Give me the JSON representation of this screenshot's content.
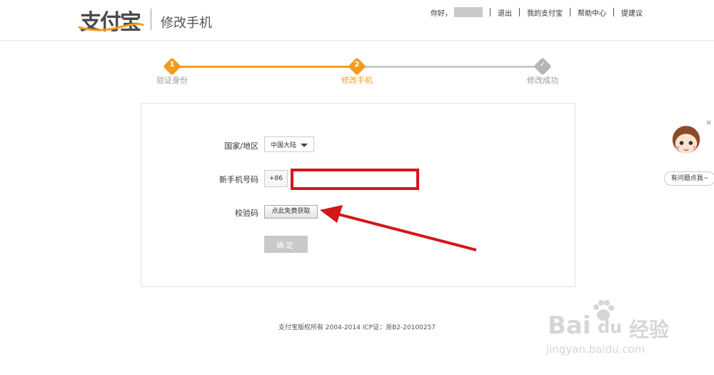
{
  "header": {
    "logo_text": "支付宝",
    "page_title": "修改手机",
    "greeting": "你好，",
    "nav": [
      "退出",
      "我的支付宝",
      "帮助中心",
      "提建议"
    ]
  },
  "steps": [
    {
      "num": "1",
      "label": "验证身份",
      "state": "done"
    },
    {
      "num": "2",
      "label": "修改手机",
      "state": "current"
    },
    {
      "num": "✓",
      "label": "修改成功",
      "state": "pending"
    }
  ],
  "form": {
    "country_label": "国家/地区",
    "country_value": "中国大陆",
    "phone_label": "新手机号码",
    "phone_prefix": "+86",
    "phone_value": "",
    "code_label": "校验码",
    "sms_button": "点此免费获取",
    "confirm_button": "确定"
  },
  "footer": {
    "copyright": "支付宝版权所有 2004-2014 ICP证：浙B2-20100257"
  },
  "help": {
    "close": "×",
    "label": "有问题点我~"
  },
  "watermark": {
    "brand": "Bai",
    "brand2": "du",
    "suffix": "经验",
    "url": "jingyan.baidu.com"
  },
  "colors": {
    "accent": "#f29c1f",
    "pending": "#b5b5b5",
    "highlight": "#d3161b"
  }
}
